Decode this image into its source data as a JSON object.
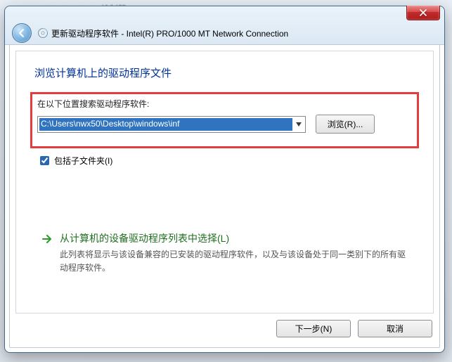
{
  "backdrop_text": "IDE ATA/ATAPI 控制器",
  "titlebar": {
    "window_title": "更新驱动程序软件 - Intel(R) PRO/1000 MT Network Connection"
  },
  "content": {
    "main_heading": "浏览计算机上的驱动程序文件",
    "search_label": "在以下位置搜索驱动程序软件:",
    "path_value": "C:\\Users\\nwx50\\Desktop\\windows\\inf",
    "browse_label": "浏览(R)...",
    "include_subfolders_label": "包括子文件夹(I)",
    "include_subfolders_checked": true,
    "pick_from_list": {
      "title": "从计算机的设备驱动程序列表中选择(L)",
      "desc": "此列表将显示与该设备兼容的已安装的驱动程序软件，以及与该设备处于同一类别下的所有驱动程序软件。"
    }
  },
  "footer": {
    "next_label": "下一步(N)",
    "cancel_label": "取消"
  },
  "colors": {
    "highlight_border": "#e43d3d",
    "heading_blue": "#003399",
    "link_green": "#1f6f1f",
    "selection_bg": "#3074c0"
  },
  "icons": {
    "back_arrow": "back-arrow-icon",
    "title_device": "driver-cd-icon",
    "close": "close-icon",
    "dropdown": "dropdown-arrow-icon",
    "option_arrow": "right-arrow-icon"
  }
}
